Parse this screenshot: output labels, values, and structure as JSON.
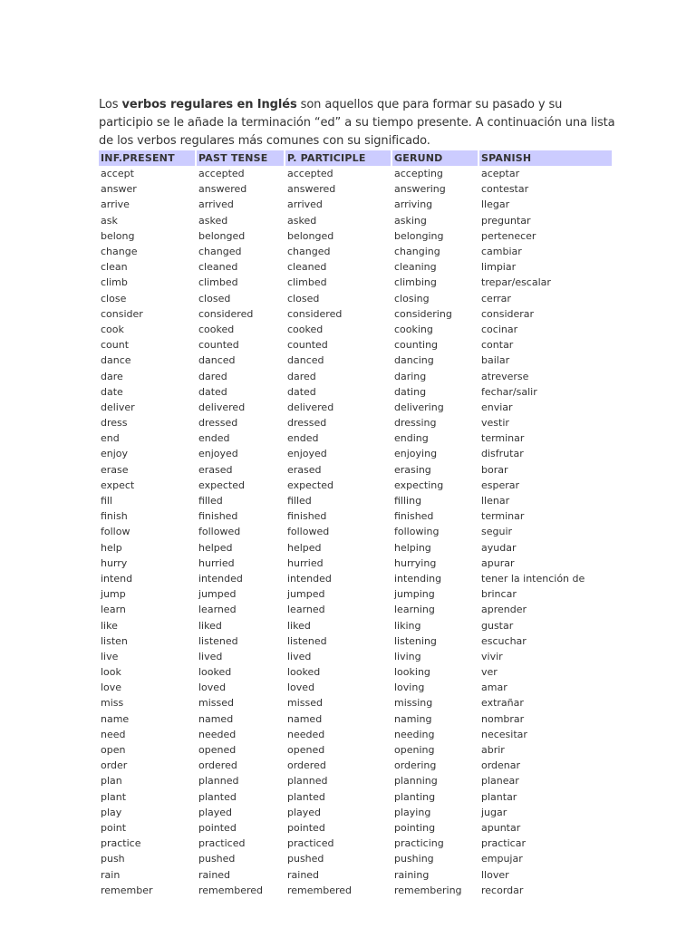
{
  "intro": {
    "prefix": "Los ",
    "bold": "verbos regulares en Inglés",
    "suffix": " son aquellos que para formar su pasado y su participio se le añade la terminación “ed” a su tiempo presente. A continuación una lista de los verbos regulares más comunes con su significado."
  },
  "table": {
    "headers": [
      "INF.PRESENT",
      "PAST TENSE",
      "P. PARTICIPLE",
      "GERUND",
      "SPANISH"
    ],
    "header_color": "#ccccff",
    "rows": [
      [
        "accept",
        "accepted",
        "accepted",
        "accepting",
        "aceptar"
      ],
      [
        "answer",
        "answered",
        "answered",
        "answering",
        "contestar"
      ],
      [
        "arrive",
        "arrived",
        "arrived",
        "arriving",
        "llegar"
      ],
      [
        "ask",
        "asked",
        "asked",
        "asking",
        "preguntar"
      ],
      [
        "belong",
        "belonged",
        "belonged",
        "belonging",
        "pertenecer"
      ],
      [
        "change",
        "changed",
        "changed",
        "changing",
        "cambiar"
      ],
      [
        "clean",
        "cleaned",
        "cleaned",
        "cleaning",
        "limpiar"
      ],
      [
        "climb",
        "climbed",
        "climbed",
        "climbing",
        "trepar/escalar"
      ],
      [
        "close",
        "closed",
        "closed",
        "closing",
        "cerrar"
      ],
      [
        "consider",
        "considered",
        "considered",
        "considering",
        "considerar"
      ],
      [
        "cook",
        "cooked",
        "cooked",
        "cooking",
        "cocinar"
      ],
      [
        "count",
        "counted",
        "counted",
        "counting",
        "contar"
      ],
      [
        "dance",
        "danced",
        "danced",
        "dancing",
        "bailar"
      ],
      [
        "dare",
        "dared",
        "dared",
        "daring",
        "atreverse"
      ],
      [
        "date",
        "dated",
        "dated",
        "dating",
        "fechar/salir"
      ],
      [
        "deliver",
        "delivered",
        "delivered",
        "delivering",
        "enviar"
      ],
      [
        "dress",
        "dressed",
        "dressed",
        "dressing",
        "vestir"
      ],
      [
        "end",
        "ended",
        "ended",
        "ending",
        "terminar"
      ],
      [
        "enjoy",
        "enjoyed",
        "enjoyed",
        "enjoying",
        "disfrutar"
      ],
      [
        "erase",
        "erased",
        "erased",
        "erasing",
        "borar"
      ],
      [
        "expect",
        "expected",
        "expected",
        "expecting",
        "esperar"
      ],
      [
        "fill",
        "filled",
        "filled",
        "filling",
        "llenar"
      ],
      [
        "finish",
        "finished",
        "finished",
        "finished",
        "terminar"
      ],
      [
        "follow",
        "followed",
        "followed",
        "following",
        "seguir"
      ],
      [
        "help",
        "helped",
        "helped",
        "helping",
        "ayudar"
      ],
      [
        "hurry",
        "hurried",
        "hurried",
        "hurrying",
        "apurar"
      ],
      [
        "intend",
        "intended",
        "intended",
        "intending",
        "tener la intención de"
      ],
      [
        "jump",
        "jumped",
        "jumped",
        "jumping",
        "brincar"
      ],
      [
        "learn",
        "learned",
        "learned",
        "learning",
        "aprender"
      ],
      [
        "like",
        "liked",
        "liked",
        "liking",
        "gustar"
      ],
      [
        "listen",
        "listened",
        "listened",
        "listening",
        "escuchar"
      ],
      [
        "live",
        "lived",
        "lived",
        "living",
        "vivir"
      ],
      [
        "look",
        "looked",
        "looked",
        "looking",
        "ver"
      ],
      [
        "love",
        "loved",
        "loved",
        "loving",
        "amar"
      ],
      [
        "miss",
        "missed",
        "missed",
        "missing",
        "extrañar"
      ],
      [
        "name",
        "named",
        "named",
        "naming",
        "nombrar"
      ],
      [
        "need",
        "needed",
        "needed",
        "needing",
        "necesitar"
      ],
      [
        "open",
        "opened",
        "opened",
        "opening",
        "abrir"
      ],
      [
        "order",
        "ordered",
        "ordered",
        "ordering",
        "ordenar"
      ],
      [
        "plan",
        "planned",
        "planned",
        "planning",
        "planear"
      ],
      [
        "plant",
        "planted",
        "planted",
        "planting",
        "plantar"
      ],
      [
        "play",
        "played",
        "played",
        "playing",
        "jugar"
      ],
      [
        "point",
        "pointed",
        "pointed",
        "pointing",
        "apuntar"
      ],
      [
        "practice",
        "practiced",
        "practiced",
        "practicing",
        "practicar"
      ],
      [
        "push",
        "pushed",
        "pushed",
        "pushing",
        "empujar"
      ],
      [
        "rain",
        "rained",
        "rained",
        "raining",
        "llover"
      ],
      [
        "remember",
        "remembered",
        "remembered",
        "remembering",
        "recordar"
      ]
    ]
  }
}
